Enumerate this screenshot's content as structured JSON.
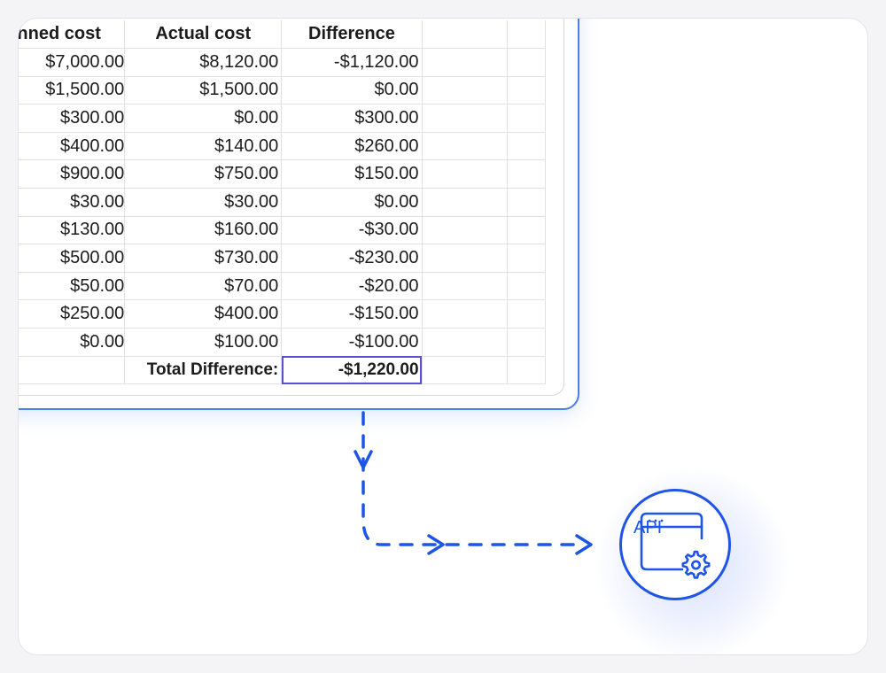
{
  "table": {
    "headers": [
      "Planned cost",
      "Actual cost",
      "Difference",
      "",
      ""
    ],
    "rows": [
      [
        "$7,000.00",
        "$8,120.00",
        "-$1,120.00"
      ],
      [
        "$1,500.00",
        "$1,500.00",
        "$0.00"
      ],
      [
        "$300.00",
        "$0.00",
        "$300.00"
      ],
      [
        "$400.00",
        "$140.00",
        "$260.00"
      ],
      [
        "$900.00",
        "$750.00",
        "$150.00"
      ],
      [
        "$30.00",
        "$30.00",
        "$0.00"
      ],
      [
        "$130.00",
        "$160.00",
        "-$30.00"
      ],
      [
        "$500.00",
        "$730.00",
        "-$230.00"
      ],
      [
        "$50.00",
        "$70.00",
        "-$20.00"
      ],
      [
        "$250.00",
        "$400.00",
        "-$150.00"
      ],
      [
        "$0.00",
        "$100.00",
        "-$100.00"
      ]
    ],
    "total_label": "Total Difference:",
    "total_value": "-$1,220.00"
  },
  "api": {
    "label": "API",
    "icon": "api-settings-icon"
  },
  "colors": {
    "accent": "#1e55e6",
    "selection": "#5b4fd6",
    "frame": "#4a7ee8"
  }
}
